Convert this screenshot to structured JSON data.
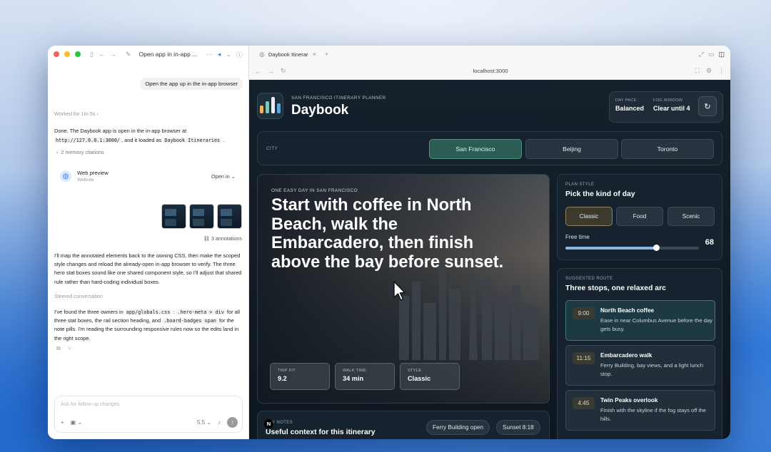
{
  "left_pane": {
    "window_title": "Open app in in-app ...",
    "user_message": "Open the app up in the in-app browser",
    "worked_for": "Worked for 1m 5s",
    "done": {
      "p1": "Done. The Daybook app is open in the in-app browser at",
      "url_code": "http://127.0.0.1:3000/",
      "p2": ", and it loaded as",
      "title_code": "Daybook Itineraries",
      "p3": "."
    },
    "memory_citations": "2 memory citations",
    "web_preview": {
      "title": "Web preview",
      "subtitle": "Website",
      "open_label": "Open in"
    },
    "annotations": "3 annotations",
    "para1": "I'll map the annotated elements back to the owning CSS, then make the scoped style changes and reload the already-open in-app browser to verify. The three hero stat boxes sound like one shared component style, so I'll adjust that shared rule rather than hard-coding individual boxes.",
    "steered": "Steered conversation",
    "para2": {
      "a": "I've found the three owners in",
      "code1": "app/globals.css",
      "b": ":",
      "code2": ".hero-meta > div",
      "c": "for all three stat boxes, the rail section heading, and",
      "code3": ".board-badges span",
      "d": "for the note pills. I'm reading the surrounding responsive rules now so the edits land in the right scope."
    },
    "composer_placeholder": "Ask for follow-up changes",
    "model_label": "5.5"
  },
  "browser": {
    "tab_title": "Daybook Itinerar",
    "url": "localhost:3000"
  },
  "app": {
    "eyebrow": "SAN FRANCISCO ITINERARY PLANNER",
    "title": "Daybook",
    "pace": {
      "label": "DAY PACE",
      "value": "Balanced"
    },
    "fog": {
      "label": "FOG WINDOW",
      "value": "Clear until 4"
    },
    "city_label": "CITY",
    "cities": [
      "San Francisco",
      "Beijing",
      "Toronto"
    ],
    "active_city": "San Francisco",
    "hero": {
      "eyebrow": "ONE EASY DAY IN SAN FRANCISCO",
      "title": "Start with coffee in North Beach, walk the Embarcadero, then finish above the bay before sunset.",
      "stats": [
        {
          "label": "TRIP FIT",
          "value": "9.2"
        },
        {
          "label": "WALK TIME",
          "value": "34 min"
        },
        {
          "label": "STYLE",
          "value": "Classic"
        }
      ]
    },
    "plan_style": {
      "eyebrow": "PLAN STYLE",
      "heading": "Pick the kind of day",
      "options": [
        "Classic",
        "Food",
        "Scenic"
      ],
      "active": "Classic",
      "free_time_label": "Free time",
      "free_time_value": "68",
      "free_time_max": 100
    },
    "route": {
      "eyebrow": "SUGGESTED ROUTE",
      "heading": "Three stops, one relaxed arc",
      "stops": [
        {
          "time": "9:00",
          "title": "North Beach coffee",
          "desc": "Ease in near Columbus Avenue before the day gets busy."
        },
        {
          "time": "11:15",
          "title": "Embarcadero walk",
          "desc": "Ferry Building, bay views, and a light lunch stop."
        },
        {
          "time": "4:45",
          "title": "Twin Peaks overlook",
          "desc": "Finish with the skyline if the fog stays off the hills."
        }
      ]
    },
    "notes": {
      "eyebrow": "Y NOTES",
      "heading": "Useful context for this itinerary",
      "pills": [
        "Ferry Building open",
        "Sunset 8:18"
      ],
      "badge": "N"
    }
  },
  "colors": {
    "accent_teal": "#2b5d55",
    "accent_gold": "#8f8660",
    "slider": "#8fb4e6"
  }
}
